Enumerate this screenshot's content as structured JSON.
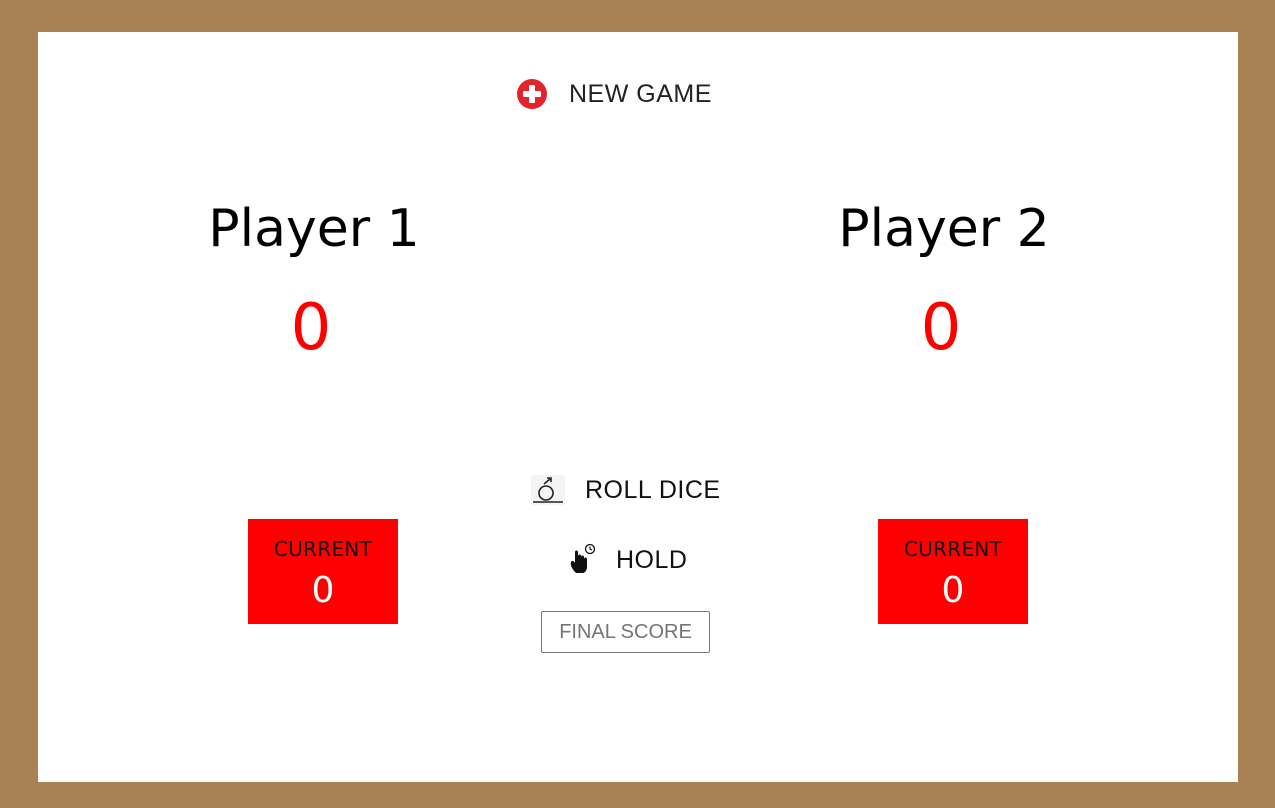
{
  "controls": {
    "new_game_label": "NEW GAME",
    "new_game_icon": "plus-circle-icon",
    "roll_label": "ROLL DICE",
    "roll_icon": "dice-roll-icon",
    "hold_label": "HOLD",
    "hold_icon": "hand-pointer-icon",
    "final_score_placeholder": "FINAL SCORE",
    "final_score_value": ""
  },
  "players": [
    {
      "name": "Player 1",
      "score": "0",
      "current_label": "CURRENT",
      "current_value": "0"
    },
    {
      "name": "Player 2",
      "score": "0",
      "current_label": "CURRENT",
      "current_value": "0"
    }
  ],
  "colors": {
    "frame": "#a88253",
    "panel": "#ffffff",
    "accent": "#ff0000",
    "icon_red": "#e3242b"
  }
}
